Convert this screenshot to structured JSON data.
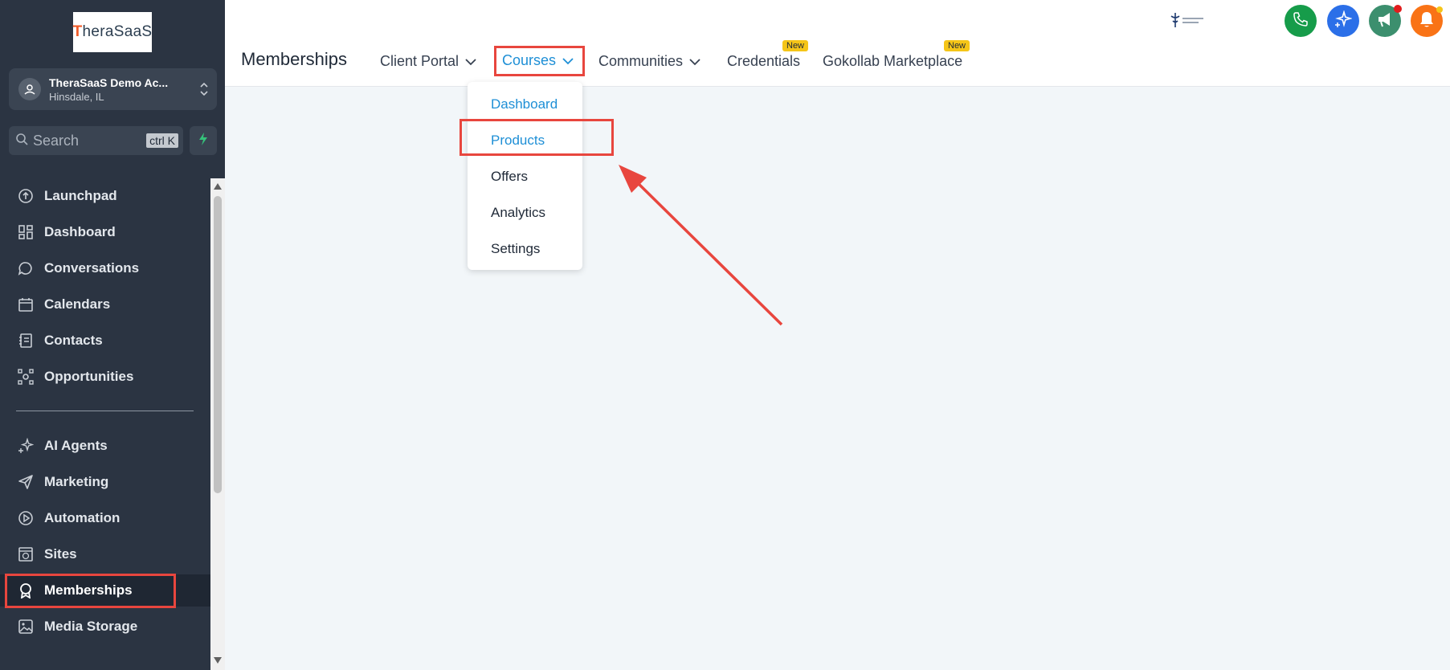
{
  "brand": {
    "logo_text_first": "T",
    "logo_text_rest": "heraSaaS"
  },
  "account": {
    "name": "TheraSaaS Demo Ac...",
    "location": "Hinsdale, IL"
  },
  "search": {
    "placeholder": "Search",
    "shortcut": "ctrl K"
  },
  "sidebar": {
    "items": [
      {
        "label": "Launchpad",
        "icon": "launchpad-icon"
      },
      {
        "label": "Dashboard",
        "icon": "grid-icon"
      },
      {
        "label": "Conversations",
        "icon": "chat-icon"
      },
      {
        "label": "Calendars",
        "icon": "calendar-icon"
      },
      {
        "label": "Contacts",
        "icon": "contacts-icon"
      },
      {
        "label": "Opportunities",
        "icon": "opportunities-icon"
      },
      {
        "label": "AI Agents",
        "icon": "sparkle-icon"
      },
      {
        "label": "Marketing",
        "icon": "send-icon"
      },
      {
        "label": "Automation",
        "icon": "automation-icon"
      },
      {
        "label": "Sites",
        "icon": "globe-icon"
      },
      {
        "label": "Memberships",
        "icon": "award-icon",
        "active": true
      },
      {
        "label": "Media Storage",
        "icon": "image-icon"
      }
    ]
  },
  "header": {
    "title": "Memberships",
    "tabs": [
      {
        "label": "Client Portal"
      },
      {
        "label": "Courses"
      },
      {
        "label": "Communities"
      },
      {
        "label": "Credentials",
        "badge": "New"
      },
      {
        "label": "Gokollab Marketplace",
        "badge": "New"
      }
    ]
  },
  "courses_menu": {
    "items": [
      "Dashboard",
      "Products",
      "Offers",
      "Analytics",
      "Settings"
    ]
  },
  "colors": {
    "sidebar_bg": "#2b3442",
    "accent_blue": "#1e8fd6",
    "highlight_red": "#e8463e",
    "phone_green": "#169c4a",
    "ai_blue": "#2b6fe8",
    "announce_teal": "#3c8f6e",
    "bell_orange": "#f97316"
  }
}
